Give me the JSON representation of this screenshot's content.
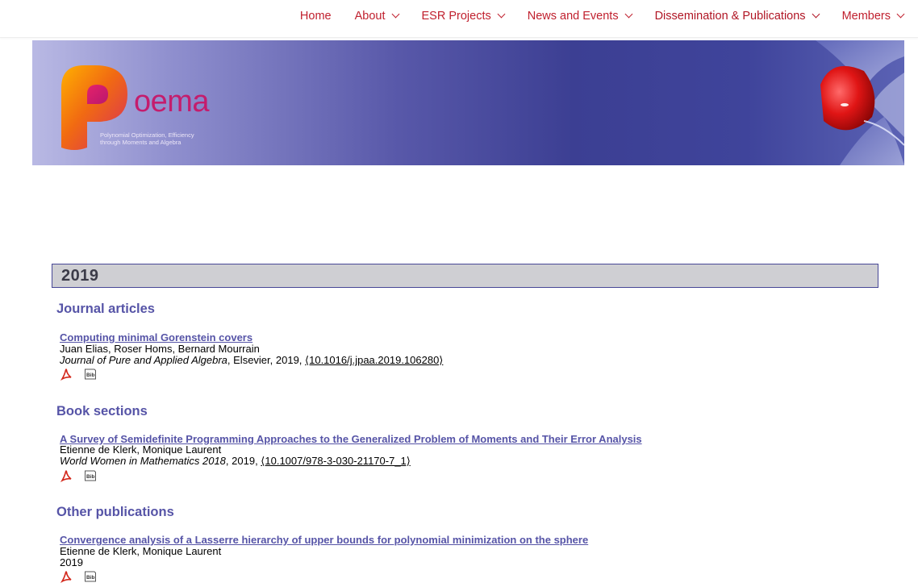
{
  "nav": {
    "items": [
      {
        "label": "Home",
        "has_dropdown": false
      },
      {
        "label": "About",
        "has_dropdown": true
      },
      {
        "label": "ESR Projects",
        "has_dropdown": true
      },
      {
        "label": "News and Events",
        "has_dropdown": true
      },
      {
        "label": "Dissemination & Publications",
        "has_dropdown": true,
        "active": true
      },
      {
        "label": "Members",
        "has_dropdown": true
      }
    ],
    "color": "#c0202e"
  },
  "banner": {
    "logo_word": "oema",
    "logo_sub_line1": "Polynomial Optimization, Efficiency",
    "logo_sub_line2": "through Moments and Algebra"
  },
  "year": "2019",
  "sections": [
    {
      "heading": "Journal articles",
      "title": "Computing minimal Gorenstein covers",
      "authors": "Juan Elias, Roser Homs, Bernard Mourrain",
      "venue": "Journal of Pure and Applied Algebra",
      "details": ", Elsevier, 2019, ",
      "doi": "⟨10.1016/j.jpaa.2019.106280⟩"
    },
    {
      "heading": "Book sections",
      "title": "A Survey of Semidefinite Programming Approaches to the Generalized Problem of Moments and Their Error Analysis",
      "authors": "Etienne de Klerk, Monique Laurent",
      "venue": "World Women in Mathematics 2018",
      "details": ", 2019, ",
      "doi": "⟨10.1007/978-3-030-21170-7_1⟩"
    },
    {
      "heading": "Other publications",
      "title": "Convergence analysis of a Lasserre hierarchy of upper bounds for polynomial minimization on the sphere",
      "authors": "Etienne de Klerk, Monique Laurent",
      "plain": "2019"
    }
  ],
  "icons": {
    "pdf": "pdf-icon",
    "bib": "bibtex-icon"
  },
  "colors": {
    "accent": "#5654a7",
    "year_bar_bg": "#cfcfd3",
    "year_bar_border": "#474796"
  }
}
